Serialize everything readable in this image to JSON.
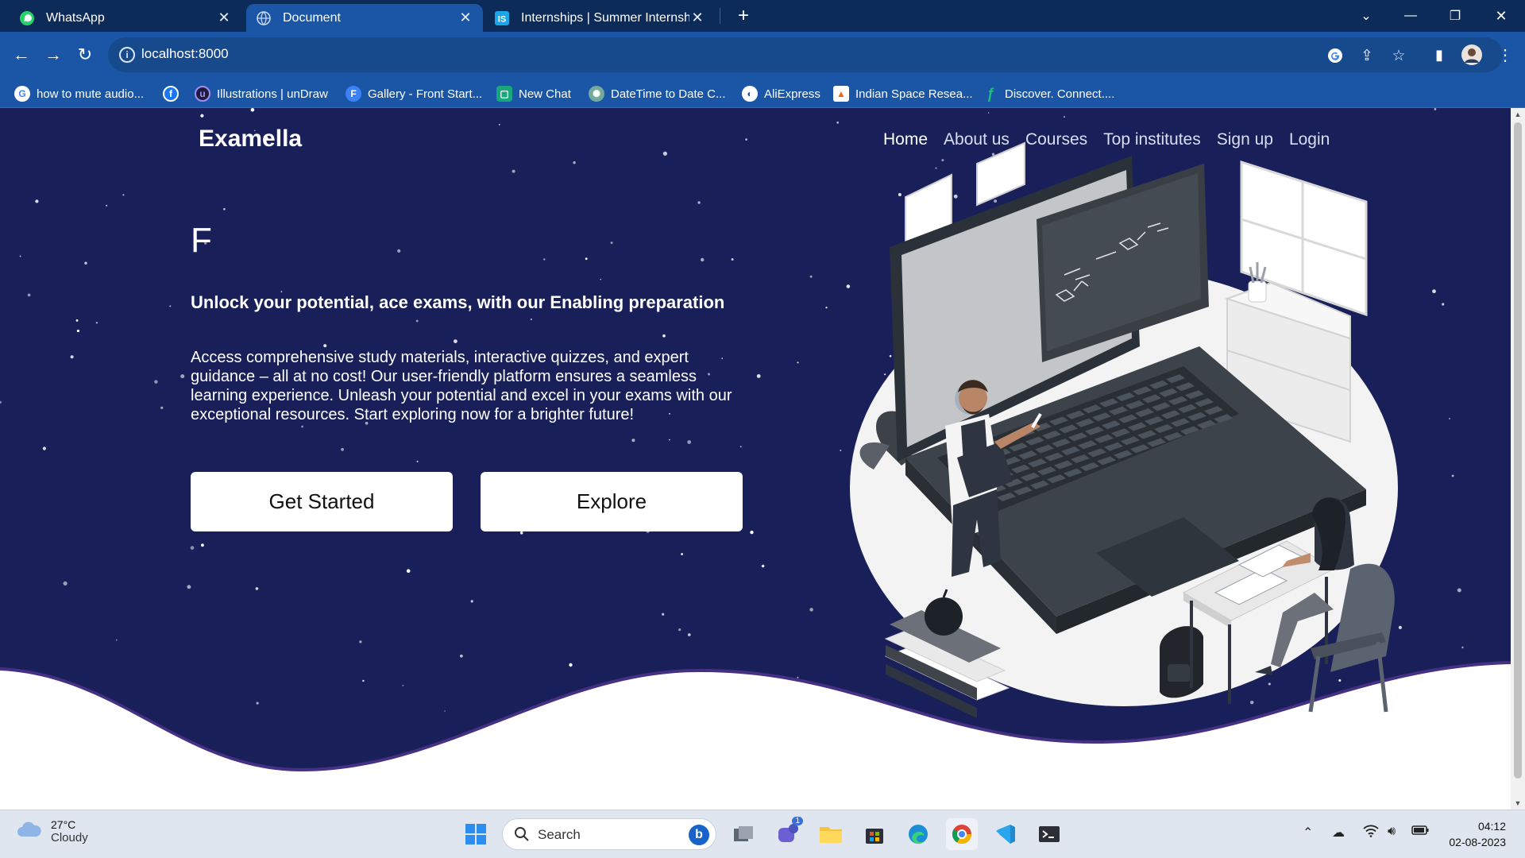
{
  "browser": {
    "tabs": [
      {
        "title": "WhatsApp",
        "icon": "whatsapp-icon",
        "active": false
      },
      {
        "title": "Document",
        "icon": "globe-icon",
        "active": true
      },
      {
        "title": "Internships | Summer Internship",
        "icon": "internshala-icon",
        "active": false
      }
    ],
    "url": "localhost:8000",
    "bookmarks": [
      {
        "label": "how to mute audio...",
        "icon": "google-icon"
      },
      {
        "label": "",
        "icon": "facebook-icon"
      },
      {
        "label": "Illustrations | unDraw",
        "icon": "undraw-icon"
      },
      {
        "label": "Gallery - Front Start...",
        "icon": "frontstart-icon"
      },
      {
        "label": "New Chat",
        "icon": "chatbot-icon"
      },
      {
        "label": "DateTime to Date C...",
        "icon": "openai-icon"
      },
      {
        "label": "AliExpress",
        "icon": "aliexpress-icon"
      },
      {
        "label": "Indian Space Resea...",
        "icon": "isro-icon"
      },
      {
        "label": "Discover. Connect....",
        "icon": "fiverr-icon"
      }
    ]
  },
  "page": {
    "brand": "Examella",
    "nav": [
      "Home",
      "About us",
      "Courses",
      "Top institutes",
      "Sign up",
      "Login"
    ],
    "typed_text": "F",
    "tagline": "Unlock your potential, ace exams, with our Enabling preparation",
    "description": "Access comprehensive study materials, interactive quizzes, and expert guidance – all at no cost! Our user-friendly platform ensures a seamless learning experience. Unleash your potential and excel in your exams with our exceptional resources. Start exploring now for a brighter future!",
    "buttons": {
      "primary": "Get Started",
      "secondary": "Explore"
    },
    "colors": {
      "background": "#192059",
      "wave": "#ffffff"
    }
  },
  "taskbar": {
    "weather": {
      "temp": "27°C",
      "condition": "Cloudy"
    },
    "search_placeholder": "Search",
    "chat_badge": "1",
    "time": "04:12",
    "date": "02-08-2023"
  }
}
